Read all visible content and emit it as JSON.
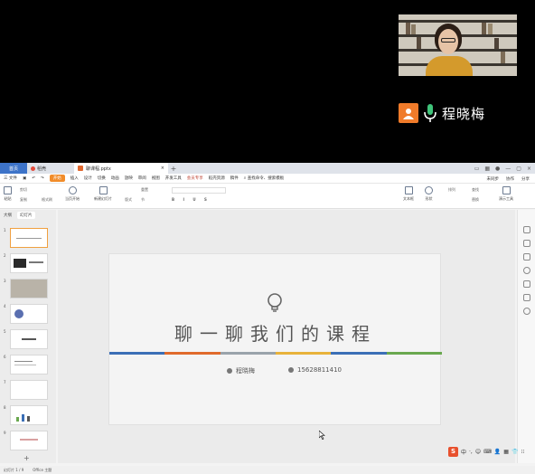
{
  "presenter": {
    "name": "程晓梅"
  },
  "tabs": {
    "home": "首页",
    "dao": "稻壳",
    "doc": "聊课程.pptx",
    "new_tab": "+"
  },
  "menubar": {
    "file": "三 文件",
    "items": [
      "开始",
      "插入",
      "设计",
      "切换",
      "动画",
      "放映",
      "审阅",
      "视图",
      "开发工具",
      "会员专享",
      "稻壳资源",
      "稿件"
    ],
    "search": "查找命令、搜索模板",
    "right": [
      "未同步",
      "协作",
      "分享"
    ]
  },
  "ribbon": {
    "paste": "粘贴",
    "cut": "剪切",
    "copy": "复制",
    "format_painter": "格式刷",
    "play_from_current": "当页开始",
    "new_slide": "新建幻灯片",
    "layout": "版式",
    "section": "节",
    "reset": "重置",
    "text_box": "文本框",
    "shape": "形状",
    "arrange": "排列",
    "find": "查找",
    "replace": "替换",
    "present_tools": "演示工具"
  },
  "sidebar": {
    "tab_outline": "大纲",
    "tab_slides": "幻灯片",
    "slide_numbers": [
      "1",
      "2",
      "3",
      "4",
      "5",
      "6",
      "7",
      "8",
      "9"
    ],
    "add": "+"
  },
  "slide": {
    "title": "聊一聊我们的课程",
    "presenter_name": "程晓梅",
    "phone": "15628811410",
    "stripe_colors": [
      "#3b6fb6",
      "#e06a2b",
      "#9aa3ab",
      "#e8b23a",
      "#3b6fb6",
      "#6aa84f"
    ]
  },
  "ime": {
    "label": "中",
    "icons": [
      "·,",
      "☺",
      "⌨",
      "👤",
      "▦",
      "👕",
      "⁝⁝"
    ]
  },
  "status": {
    "slide_info": "幻灯片 1 / 9",
    "theme": "Office 主题"
  }
}
